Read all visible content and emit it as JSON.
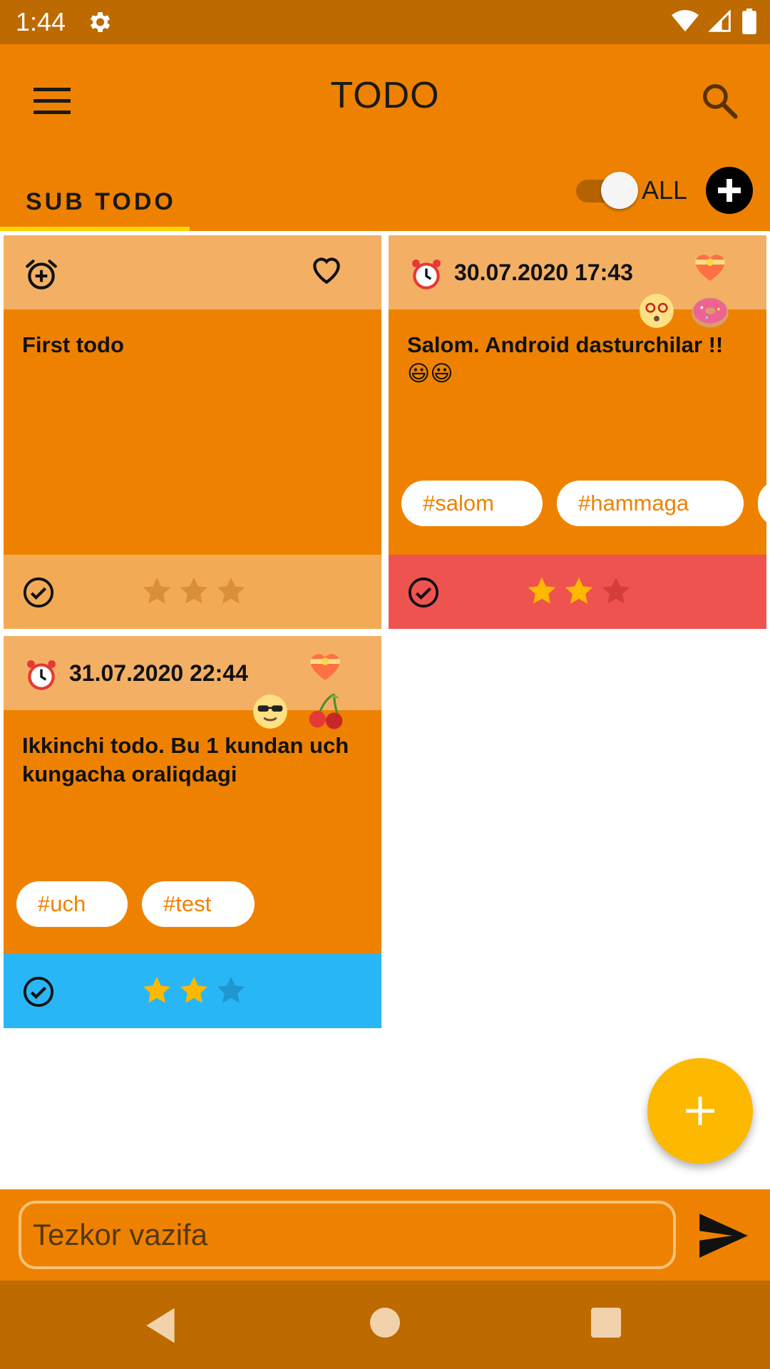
{
  "status_bar": {
    "time": "1:44"
  },
  "app_bar": {
    "title": "TODO"
  },
  "tabs": {
    "active_label": "SUB TODO",
    "toggle_label": "ALL",
    "toggle_on": true
  },
  "cards": [
    {
      "date": "",
      "text": "First todo",
      "tags": [],
      "stars_filled": 0,
      "stars_total": 3,
      "footer_color": "#F3AA55"
    },
    {
      "date": "30.07.2020 17:43",
      "text": "Salom. Android dasturchilar !! 😃😃",
      "tags": [
        "#salom",
        "#hammaga"
      ],
      "stars_filled": 2,
      "stars_total": 3,
      "footer_color": "#EF5350"
    },
    {
      "date": "31.07.2020 22:44",
      "text": "Ikkinchi todo. Bu 1 kundan uch kungacha oraliqdagi",
      "tags": [
        "#uch",
        "#test"
      ],
      "stars_filled": 2,
      "stars_total": 3,
      "footer_color": "#29B6F6"
    }
  ],
  "quick_task": {
    "placeholder": "Tezkor vazifa",
    "value": ""
  },
  "colors": {
    "status_bar": "#BD6A00",
    "primary": "#EE8200",
    "card_header": "#F3B065",
    "fab": "#FDB800",
    "star_filled": "#FDB800"
  },
  "icons": {
    "status": [
      "gear-icon",
      "wifi-icon",
      "signal-icon",
      "battery-icon"
    ],
    "app_bar": [
      "menu-icon",
      "search-icon"
    ],
    "card": [
      "alarm-add-icon",
      "heart-outline-icon",
      "alarm-clock-icon",
      "heart-bow-icon",
      "check-circle-icon",
      "star-icon"
    ],
    "bottom": [
      "plus-icon",
      "send-icon",
      "back-icon",
      "home-icon",
      "recents-icon"
    ]
  }
}
